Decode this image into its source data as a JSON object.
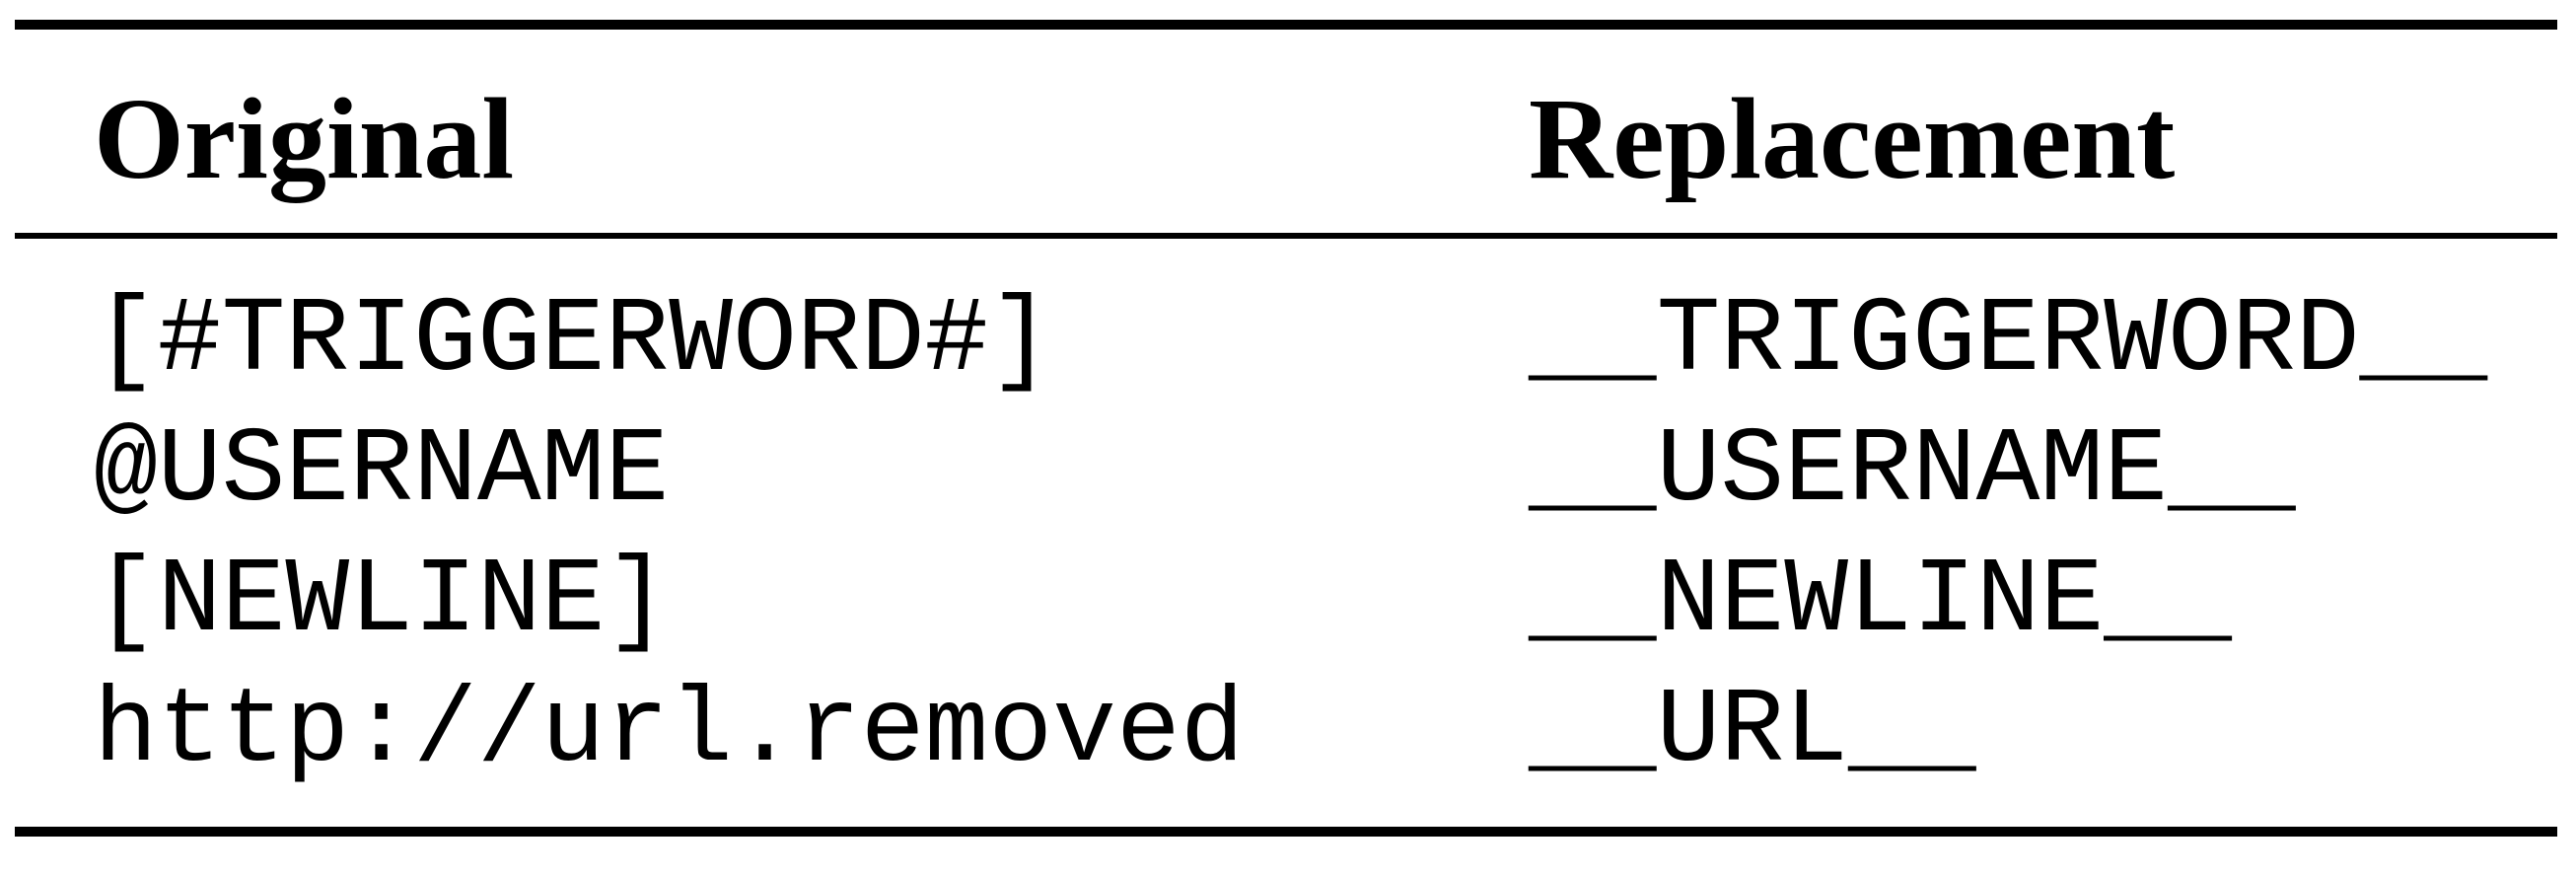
{
  "table": {
    "headers": {
      "original": "Original",
      "replacement": "Replacement"
    },
    "rows": [
      {
        "original": "[#TRIGGERWORD#]",
        "replacement": "__TRIGGERWORD__"
      },
      {
        "original": "@USERNAME",
        "replacement": "__USERNAME__"
      },
      {
        "original": "[NEWLINE]",
        "replacement": "__NEWLINE__"
      },
      {
        "original": "http://url.removed",
        "replacement": "__URL__"
      }
    ]
  }
}
